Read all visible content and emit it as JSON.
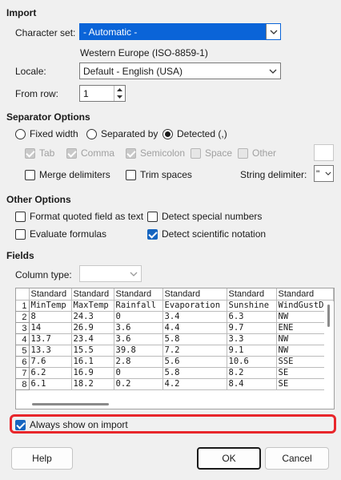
{
  "import": {
    "title": "Import",
    "charset_label": "Character set:",
    "charset_value": "- Automatic -",
    "charset_detected": "Western Europe (ISO-8859-1)",
    "locale_label": "Locale:",
    "locale_value": "Default - English (USA)",
    "from_row_label": "From row:",
    "from_row_value": "1"
  },
  "separator": {
    "title": "Separator Options",
    "fixed_width": "Fixed width",
    "separated_by": "Separated by",
    "detected": "Detected (,)",
    "tab": "Tab",
    "comma": "Comma",
    "semicolon": "Semicolon",
    "space": "Space",
    "other": "Other",
    "merge_delimiters": "Merge delimiters",
    "trim_spaces": "Trim spaces",
    "string_delimiter_label": "String delimiter:",
    "string_delimiter_value": "\""
  },
  "other_options": {
    "title": "Other Options",
    "format_quoted": "Format quoted field as text",
    "detect_special": "Detect special numbers",
    "evaluate_formulas": "Evaluate formulas",
    "detect_scientific": "Detect scientific notation"
  },
  "fields": {
    "title": "Fields",
    "column_type_label": "Column type:",
    "column_type_value": ""
  },
  "preview": {
    "types": [
      "Standard",
      "Standard",
      "Standard",
      "Standard",
      "Standard",
      "Standard"
    ],
    "rows": [
      {
        "n": "1",
        "cells": [
          "MinTemp",
          "MaxTemp",
          "Rainfall",
          "Evaporation",
          "Sunshine",
          "WindGustD"
        ]
      },
      {
        "n": "2",
        "cells": [
          "8",
          "24.3",
          "0",
          "3.4",
          "6.3",
          "NW"
        ]
      },
      {
        "n": "3",
        "cells": [
          "14",
          "26.9",
          "3.6",
          "4.4",
          "9.7",
          "ENE"
        ]
      },
      {
        "n": "4",
        "cells": [
          "13.7",
          "23.4",
          "3.6",
          "5.8",
          "3.3",
          "NW"
        ]
      },
      {
        "n": "5",
        "cells": [
          "13.3",
          "15.5",
          "39.8",
          "7.2",
          "9.1",
          "NW"
        ]
      },
      {
        "n": "6",
        "cells": [
          "7.6",
          "16.1",
          "2.8",
          "5.6",
          "10.6",
          "SSE"
        ]
      },
      {
        "n": "7",
        "cells": [
          "6.2",
          "16.9",
          "0",
          "5.8",
          "8.2",
          "SE"
        ]
      },
      {
        "n": "8",
        "cells": [
          "6.1",
          "18.2",
          "0.2",
          "4.2",
          "8.4",
          "SE"
        ]
      }
    ]
  },
  "always_show": "Always show on import",
  "buttons": {
    "help": "Help",
    "ok": "OK",
    "cancel": "Cancel"
  },
  "colors": {
    "accent": "#0a64d8",
    "highlight": "#e8262b"
  }
}
